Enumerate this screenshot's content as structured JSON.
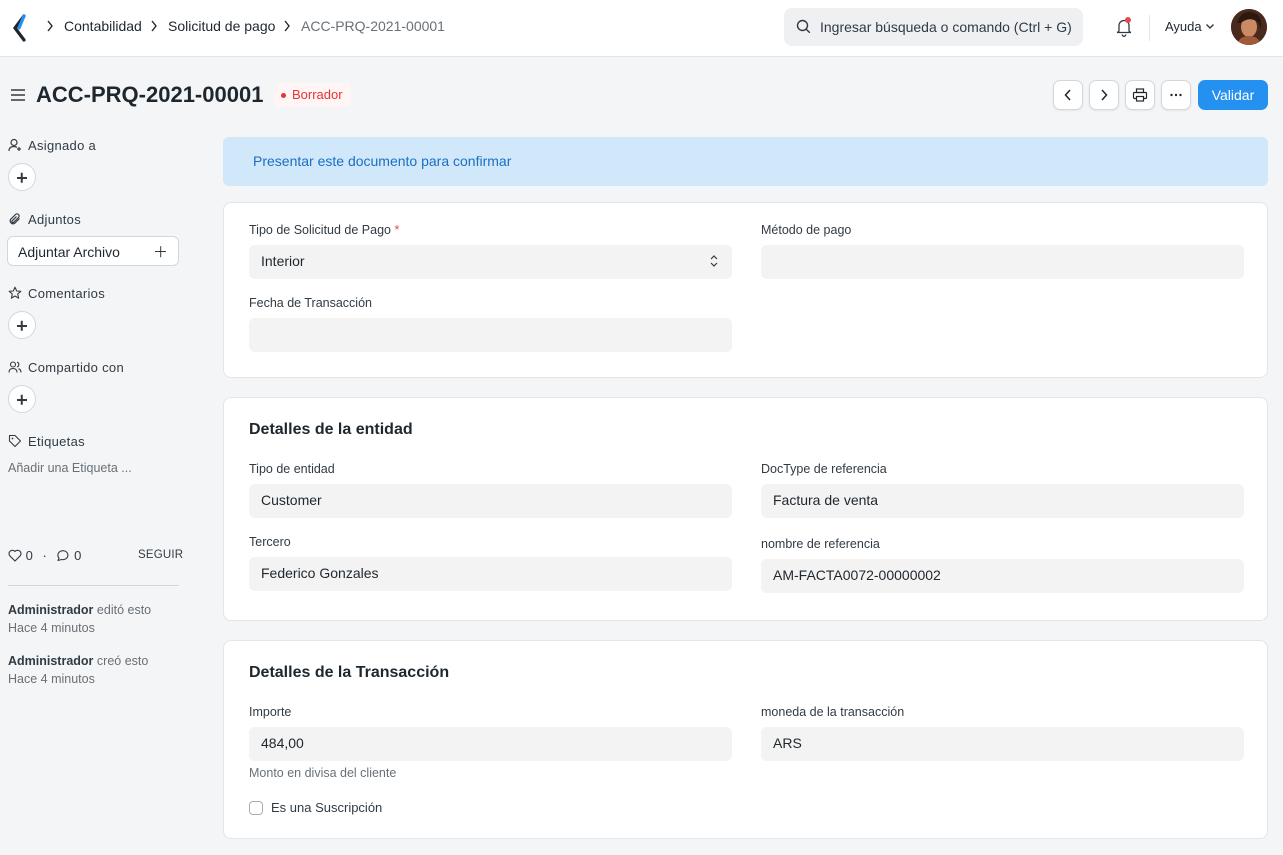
{
  "breadcrumb": {
    "items": [
      "Contabilidad",
      "Solicitud de pago",
      "ACC-PRQ-2021-00001"
    ]
  },
  "search": {
    "placeholder": "Ingresar búsqueda o comando (Ctrl + G)"
  },
  "navbar": {
    "help_label": "Ayuda"
  },
  "page": {
    "title": "ACC-PRQ-2021-00001",
    "status": "Borrador",
    "primary_action": "Validar"
  },
  "sidebar": {
    "assigned_label": "Asignado a",
    "attachments_label": "Adjuntos",
    "attach_button": "Adjuntar Archivo",
    "comments_label": "Comentarios",
    "shared_label": "Compartido con",
    "tags_label": "Etiquetas",
    "tag_placeholder": "Añadir una Etiqueta ...",
    "likes_count": "0",
    "comments_count": "0",
    "follow_label": "SEGUIR",
    "activity": [
      {
        "user": "Administrador",
        "action": "editó esto",
        "time": "Hace 4 minutos"
      },
      {
        "user": "Administrador",
        "action": "creó esto",
        "time": "Hace 4 minutos"
      }
    ]
  },
  "banner": {
    "text": "Presentar este documento para confirmar"
  },
  "section1": {
    "payment_request_type_label": "Tipo de Solicitud de Pago",
    "payment_request_type_value": "Interior",
    "payment_method_label": "Método de pago",
    "payment_method_value": "",
    "transaction_date_label": "Fecha de Transacción",
    "transaction_date_value": ""
  },
  "section2": {
    "title": "Detalles de la entidad",
    "party_type_label": "Tipo de entidad",
    "party_type_value": "Customer",
    "reference_doctype_label": "DocType de referencia",
    "reference_doctype_value": "Factura de venta",
    "party_label": "Tercero",
    "party_value": "Federico Gonzales",
    "reference_name_label": "nombre de referencia",
    "reference_name_value": "AM-FACTA0072-00000002"
  },
  "section3": {
    "title": "Detalles de la Transacción",
    "amount_label": "Importe",
    "amount_value": "484,00",
    "amount_description": "Monto en divisa del cliente",
    "currency_label": "moneda de la transacción",
    "currency_value": "ARS",
    "subscription_label": "Es una Suscripción"
  }
}
